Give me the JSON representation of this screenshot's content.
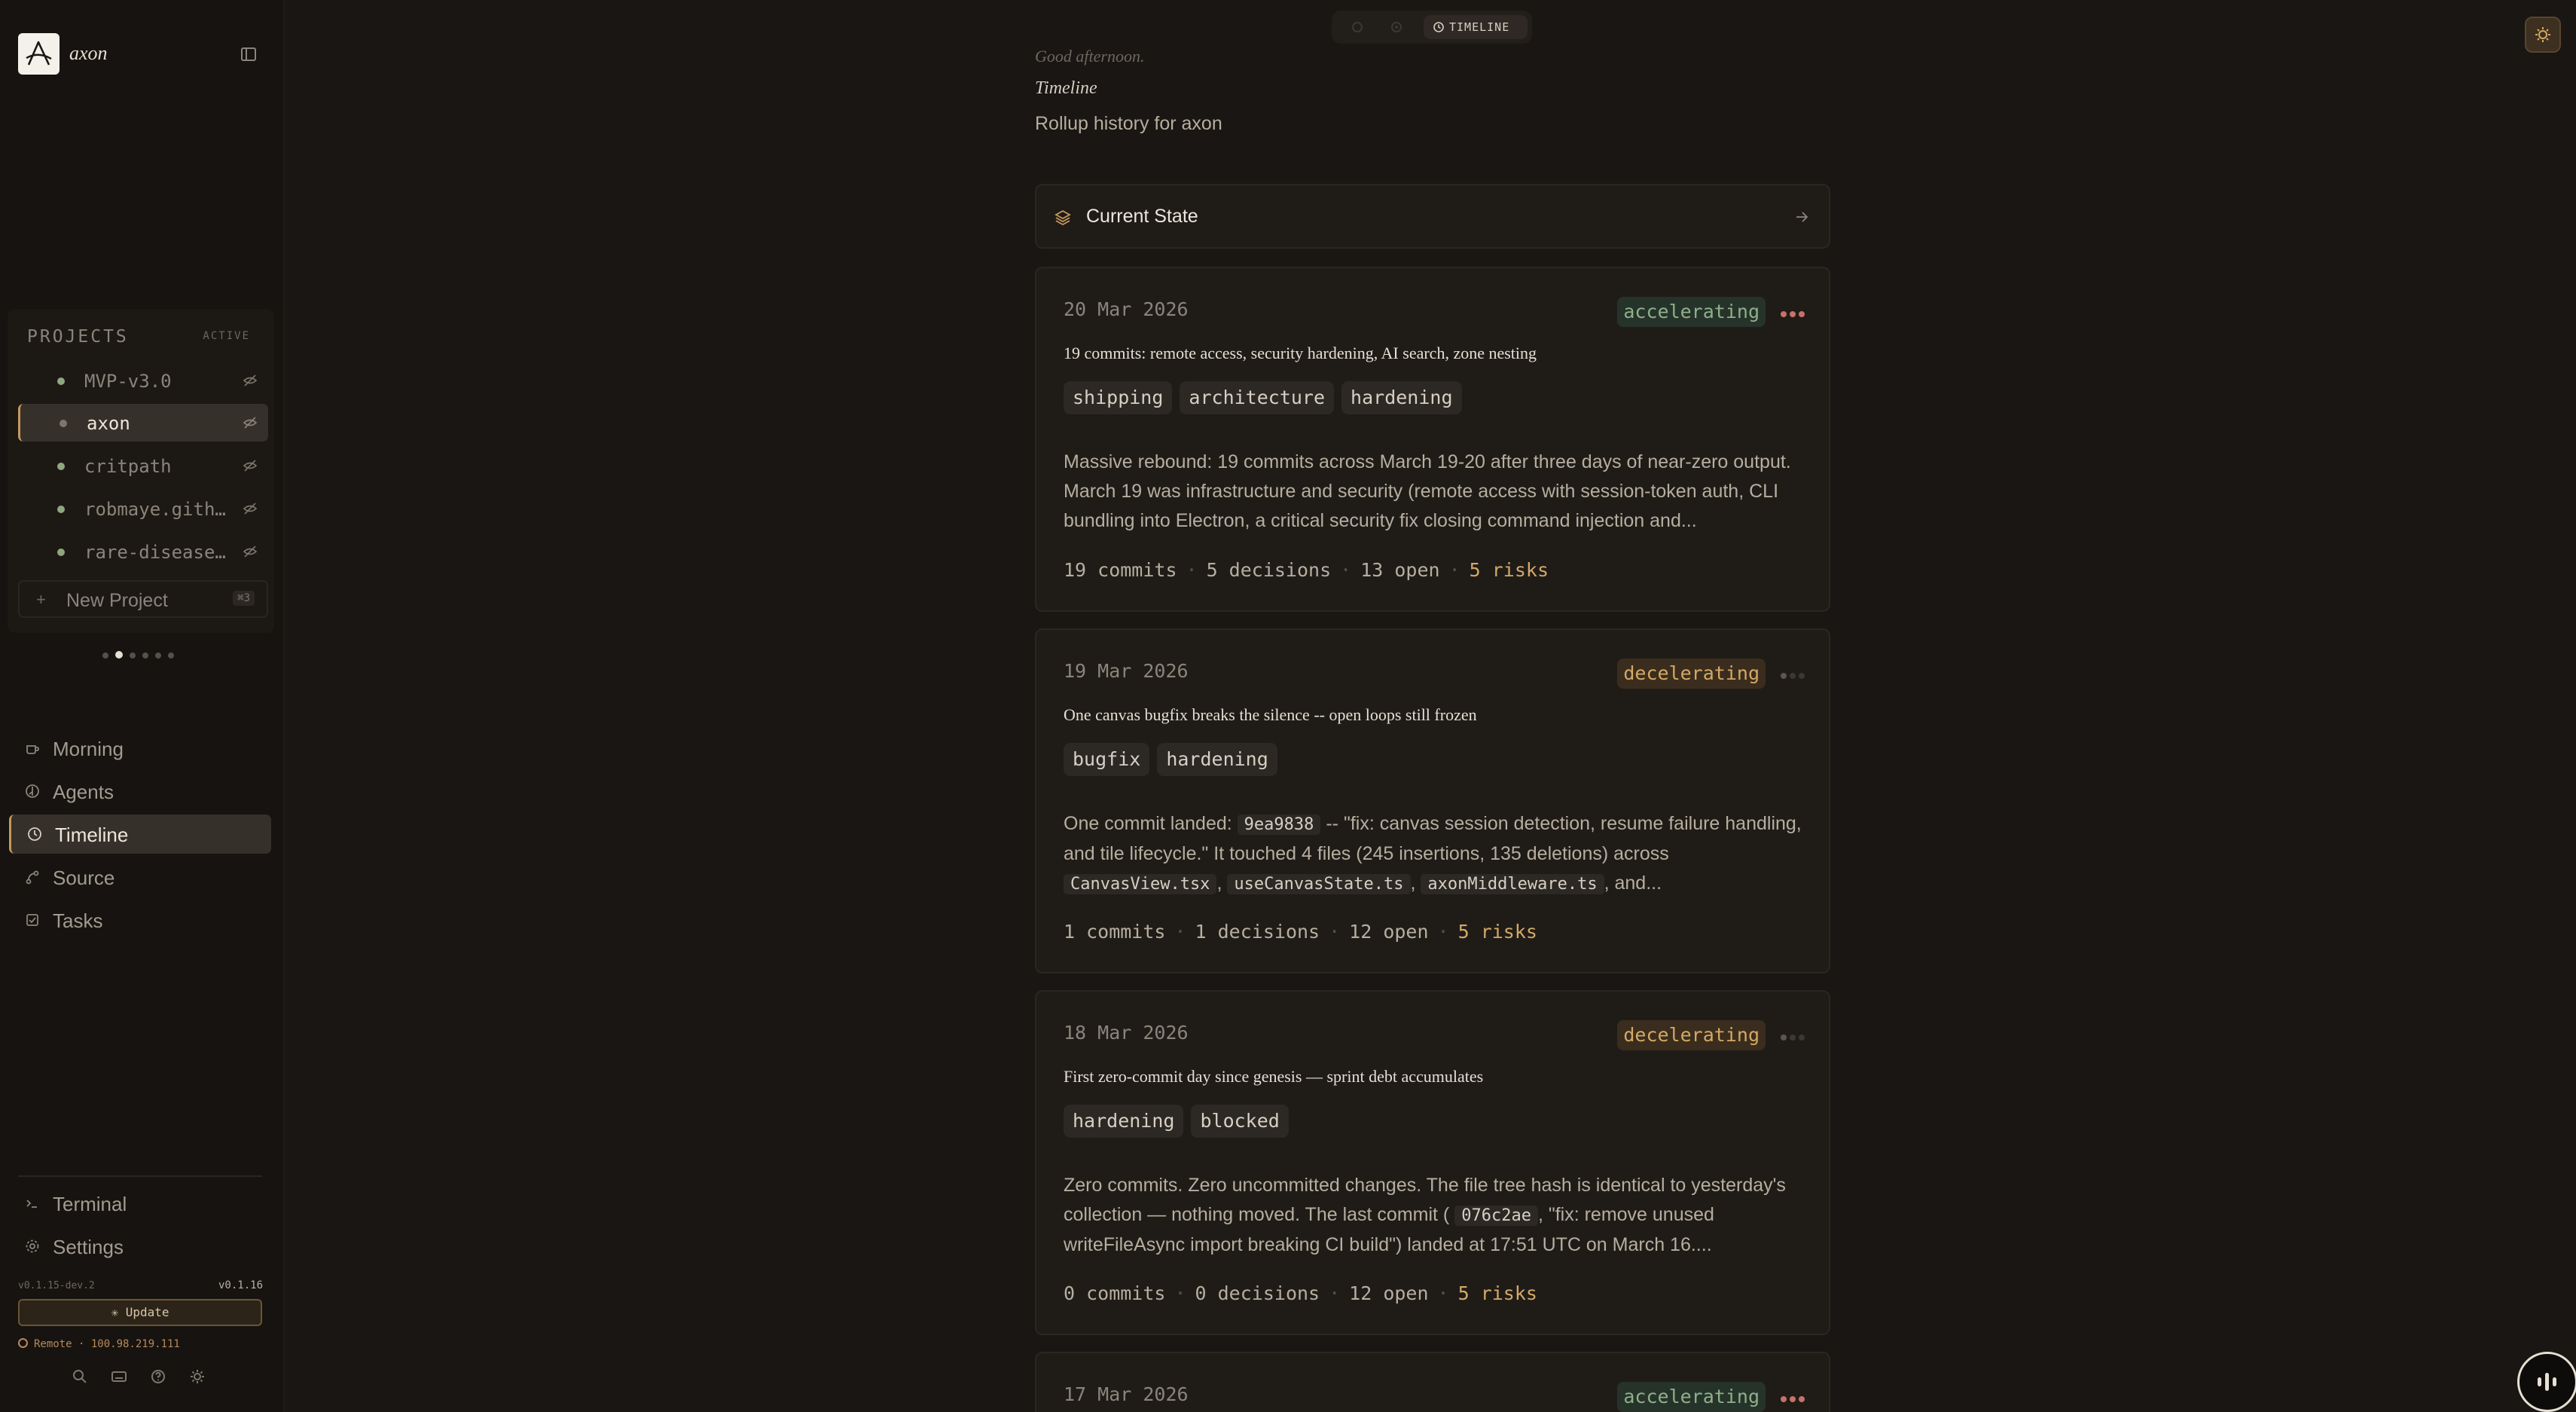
{
  "app": {
    "name": "axon"
  },
  "sidebar": {
    "projects_header": "PROJECTS",
    "projects_active_label": "ACTIVE",
    "projects": [
      {
        "name": "MVP-v3.0",
        "selected": false
      },
      {
        "name": "axon",
        "selected": true
      },
      {
        "name": "critpath",
        "selected": false
      },
      {
        "name": "robmaye.github.io",
        "selected": false
      },
      {
        "name": "rare-disease-research",
        "selected": false
      }
    ],
    "new_project_label": "New Project",
    "new_project_shortcut": "⌘3",
    "nav": [
      {
        "label": "Morning",
        "icon": "coffee-icon"
      },
      {
        "label": "Agents",
        "icon": "agents-icon"
      },
      {
        "label": "Timeline",
        "icon": "clock-icon",
        "selected": true
      },
      {
        "label": "Source",
        "icon": "git-branch-icon"
      },
      {
        "label": "Tasks",
        "icon": "checkbox-icon"
      }
    ],
    "bottom_nav": [
      {
        "label": "Terminal",
        "icon": "terminal-icon"
      },
      {
        "label": "Settings",
        "icon": "gear-icon"
      }
    ],
    "version_current": "v0.1.15-dev.2",
    "version_latest": "v0.1.16",
    "update_label": "Update",
    "remote_label": "Remote · 100.98.219.111"
  },
  "topbar": {
    "active_view_label": "TIMELINE"
  },
  "main": {
    "greeting": "Good afternoon.",
    "title": "Timeline",
    "subtitle": "Rollup history for axon",
    "current_state_label": "Current State",
    "cards": [
      {
        "date": "20 Mar 2026",
        "momentum": "accelerating",
        "headline": "19 commits: remote access, security hardening, AI search, zone nesting",
        "tags": [
          "shipping",
          "architecture",
          "hardening"
        ],
        "body": "Massive rebound: 19 commits across March 19-20 after three days of near-zero output. March 19 was infrastructure and security (remote access with session-token auth, CLI bundling into Electron, a critical security fix closing command injection and...",
        "commits": "19 commits",
        "decisions": "5 decisions",
        "open": "13 open",
        "risks": "5 risks"
      },
      {
        "date": "19 Mar 2026",
        "momentum": "decelerating",
        "headline": "One canvas bugfix breaks the silence -- open loops still frozen",
        "tags": [
          "bugfix",
          "hardening"
        ],
        "body_pre": "One commit landed:",
        "body_code1": "9ea9838",
        "body_mid": "-- \"fix: canvas session detection, resume failure handling, and tile lifecycle.\" It touched 4 files (245 insertions, 135 deletions) across",
        "body_files": [
          "CanvasView.tsx",
          "useCanvasState.ts",
          "axonMiddleware.ts"
        ],
        "body_end": ", and...",
        "commits": "1 commits",
        "decisions": "1 decisions",
        "open": "12 open",
        "risks": "5 risks"
      },
      {
        "date": "18 Mar 2026",
        "momentum": "decelerating",
        "headline": "First zero-commit day since genesis — sprint debt accumulates",
        "tags": [
          "hardening",
          "blocked"
        ],
        "body_pre": "Zero commits. Zero uncommitted changes. The file tree hash is identical to yesterday's collection — nothing moved. The last commit (",
        "body_code1": "076c2ae",
        "body_end": ", \"fix: remove unused writeFileAsync import breaking CI build\") landed at 17:51 UTC on March 16....",
        "commits": "0 commits",
        "decisions": "0 decisions",
        "open": "12 open",
        "risks": "5 risks"
      },
      {
        "date": "17 Mar 2026",
        "momentum": "accelerating"
      }
    ]
  },
  "colors": {
    "accelerating": "#8fb08a",
    "decelerating": "#d4a866",
    "accent": "#c59a5c",
    "risk": "#d4a866"
  }
}
